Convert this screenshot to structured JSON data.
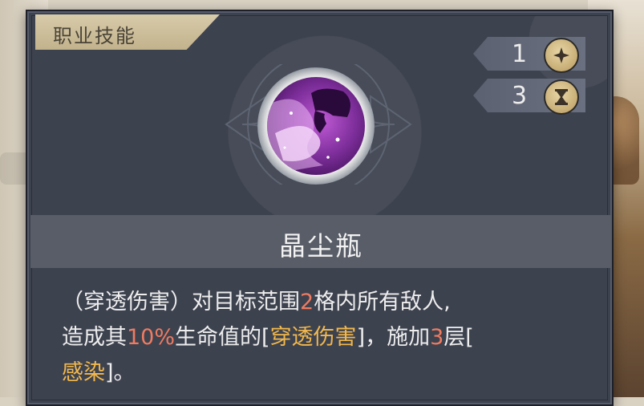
{
  "panel": {
    "category_tab": "职业技能",
    "skill_name": "晶尘瓶"
  },
  "stats": [
    {
      "value": "1",
      "icon": "sparkle-icon"
    },
    {
      "value": "3",
      "icon": "hourglass-icon"
    }
  ],
  "description": {
    "p1": "（穿透伤害）对目标范围",
    "n_range": "2",
    "p2": "格内所有敌人,",
    "p3": "造成其",
    "n_percent": "10%",
    "p4": "生命值的[",
    "k_pierce": "穿透伤害",
    "p5": "]，施加",
    "n_stacks": "3",
    "p6": "层[",
    "k_infect": "感染",
    "p7": "]。"
  },
  "colors": {
    "panel_bg": "#3d424f",
    "name_bar": "#585d68",
    "number_highlight": "#ef7b60",
    "keyword_highlight": "#f2b84d",
    "tab_gold": "#d8cbaa"
  }
}
